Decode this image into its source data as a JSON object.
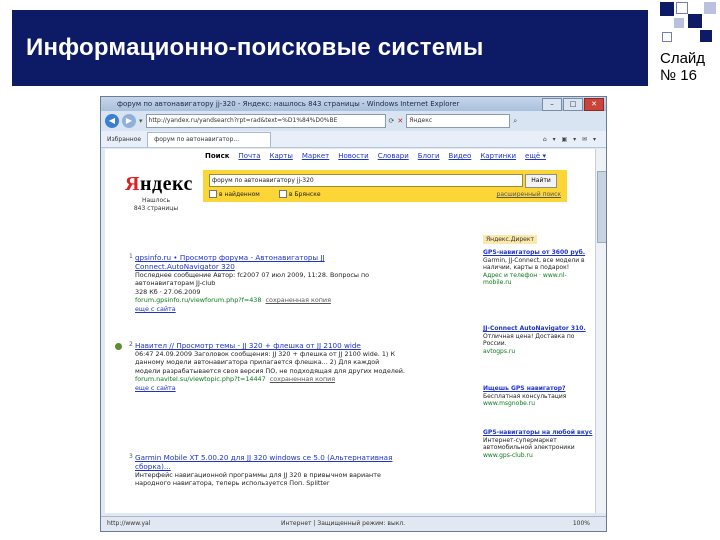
{
  "slide": {
    "title": "Информационно-поисковые системы",
    "label_line1": "Слайд",
    "label_line2": "№ 16"
  },
  "colors": {
    "banner": "#0d1a66",
    "yandex_bar": "#fcd636",
    "link": "#1e34c8",
    "url": "#0c7a1a"
  },
  "browser": {
    "title": "форум по автонавигатору jj-320 - Яндекс: нашлось 843 страницы - Windows Internet Explorer",
    "address": "http://yandex.ru/yandsearch?rpt=rad&text=%D1%84%D0%BE",
    "search_box": "Яндекс",
    "favorites": "Избранное",
    "tab_title": "форум по автонавигатор...",
    "tab_tools": "⌂ ▾ ▣ ▾ ✉ ▾",
    "controls": [
      "–",
      "□",
      "✕"
    ],
    "status_url": "http://www.yal",
    "status_zone": "Интернет | Защищенный режим: выкл.",
    "status_zoom": "100%"
  },
  "yandex": {
    "nav": [
      {
        "label": "Поиск",
        "active": true
      },
      {
        "label": "Почта"
      },
      {
        "label": "Карты"
      },
      {
        "label": "Маркет"
      },
      {
        "label": "Новости"
      },
      {
        "label": "Словари"
      },
      {
        "label": "Блоги"
      },
      {
        "label": "Видео"
      },
      {
        "label": "Картинки"
      },
      {
        "label": "ещё ▾"
      }
    ],
    "logo_first": "Я",
    "logo_rest": "ндекс",
    "found_line1": "Нашлось",
    "found_line2": "843 страницы",
    "query": "форум по автонавигатору jj-320",
    "search_button": "Найти",
    "check_found": "в найденном",
    "check_region": "в Брянске",
    "advanced": "расширенный поиск",
    "direct_header": "Яндекс.Директ",
    "results": [
      {
        "num": "1",
        "title": "gpsinfo.ru • Просмотр форума - Автонавигаторы JJ Connect.AutoNavigator 320",
        "snippet": "Последнее сообщение Автор: fc2007 07 июл 2009, 11:28. Вопросы по автонавигаторам JJ-club",
        "extra": "328 Кб · 27.06.2009",
        "url": "forum.gpsinfo.ru/viewforum.php?f=438",
        "cache_extra": "сохраненная копия",
        "more": "еще с сайта"
      },
      {
        "num": "2",
        "title": "Навител // Просмотр темы - JJ 320 + флешка от JJ 2100 wide",
        "snippet": "06:47 24.09.2009 Заголовок сообщения: JJ 320 + флешка от JJ 2100 wide. 1) К данному модели автонавигатора прилагается флешка... 2) Для каждой модели разрабатывается своя версия ПО, не подходящая для других моделей.",
        "extra": "",
        "url": "forum.navitel.su/viewtopic.php?t=14447",
        "cache_extra": "сохраненная копия",
        "more": "еще с сайта"
      },
      {
        "num": "3",
        "title": "Garmin Mobile XT 5.00.20 для JJ 320 windows ce 5.0 (Альтернативная сборка)...",
        "snippet": "Интерфейс навигационной программы для JJ 320 в привычном варианте народного навигатора, теперь используется Поп. Splitter",
        "extra": "",
        "url": "",
        "cache_extra": "",
        "more": ""
      }
    ],
    "ads": [
      {
        "title": "GPS-навигаторы от 3600 руб.",
        "text": "Garmin, JJ-Connect, все модели в наличии, карты в подарок!",
        "url": "Адрес и телефон · www.nl-mobile.ru"
      },
      {
        "title": "JJ-Connect AutoNavigator 310.",
        "text": "Отличная цена! Доставка по России.",
        "url": "avtogps.ru"
      },
      {
        "title": "Ищешь GPS навигатор?",
        "text": "Бесплатная консультация",
        "url": "www.msgnobe.ru"
      },
      {
        "title": "GPS-навигаторы на любой вкус",
        "text": "Интернет-супермаркет автомобильной электроники",
        "url": "www.gps-club.ru"
      }
    ]
  }
}
